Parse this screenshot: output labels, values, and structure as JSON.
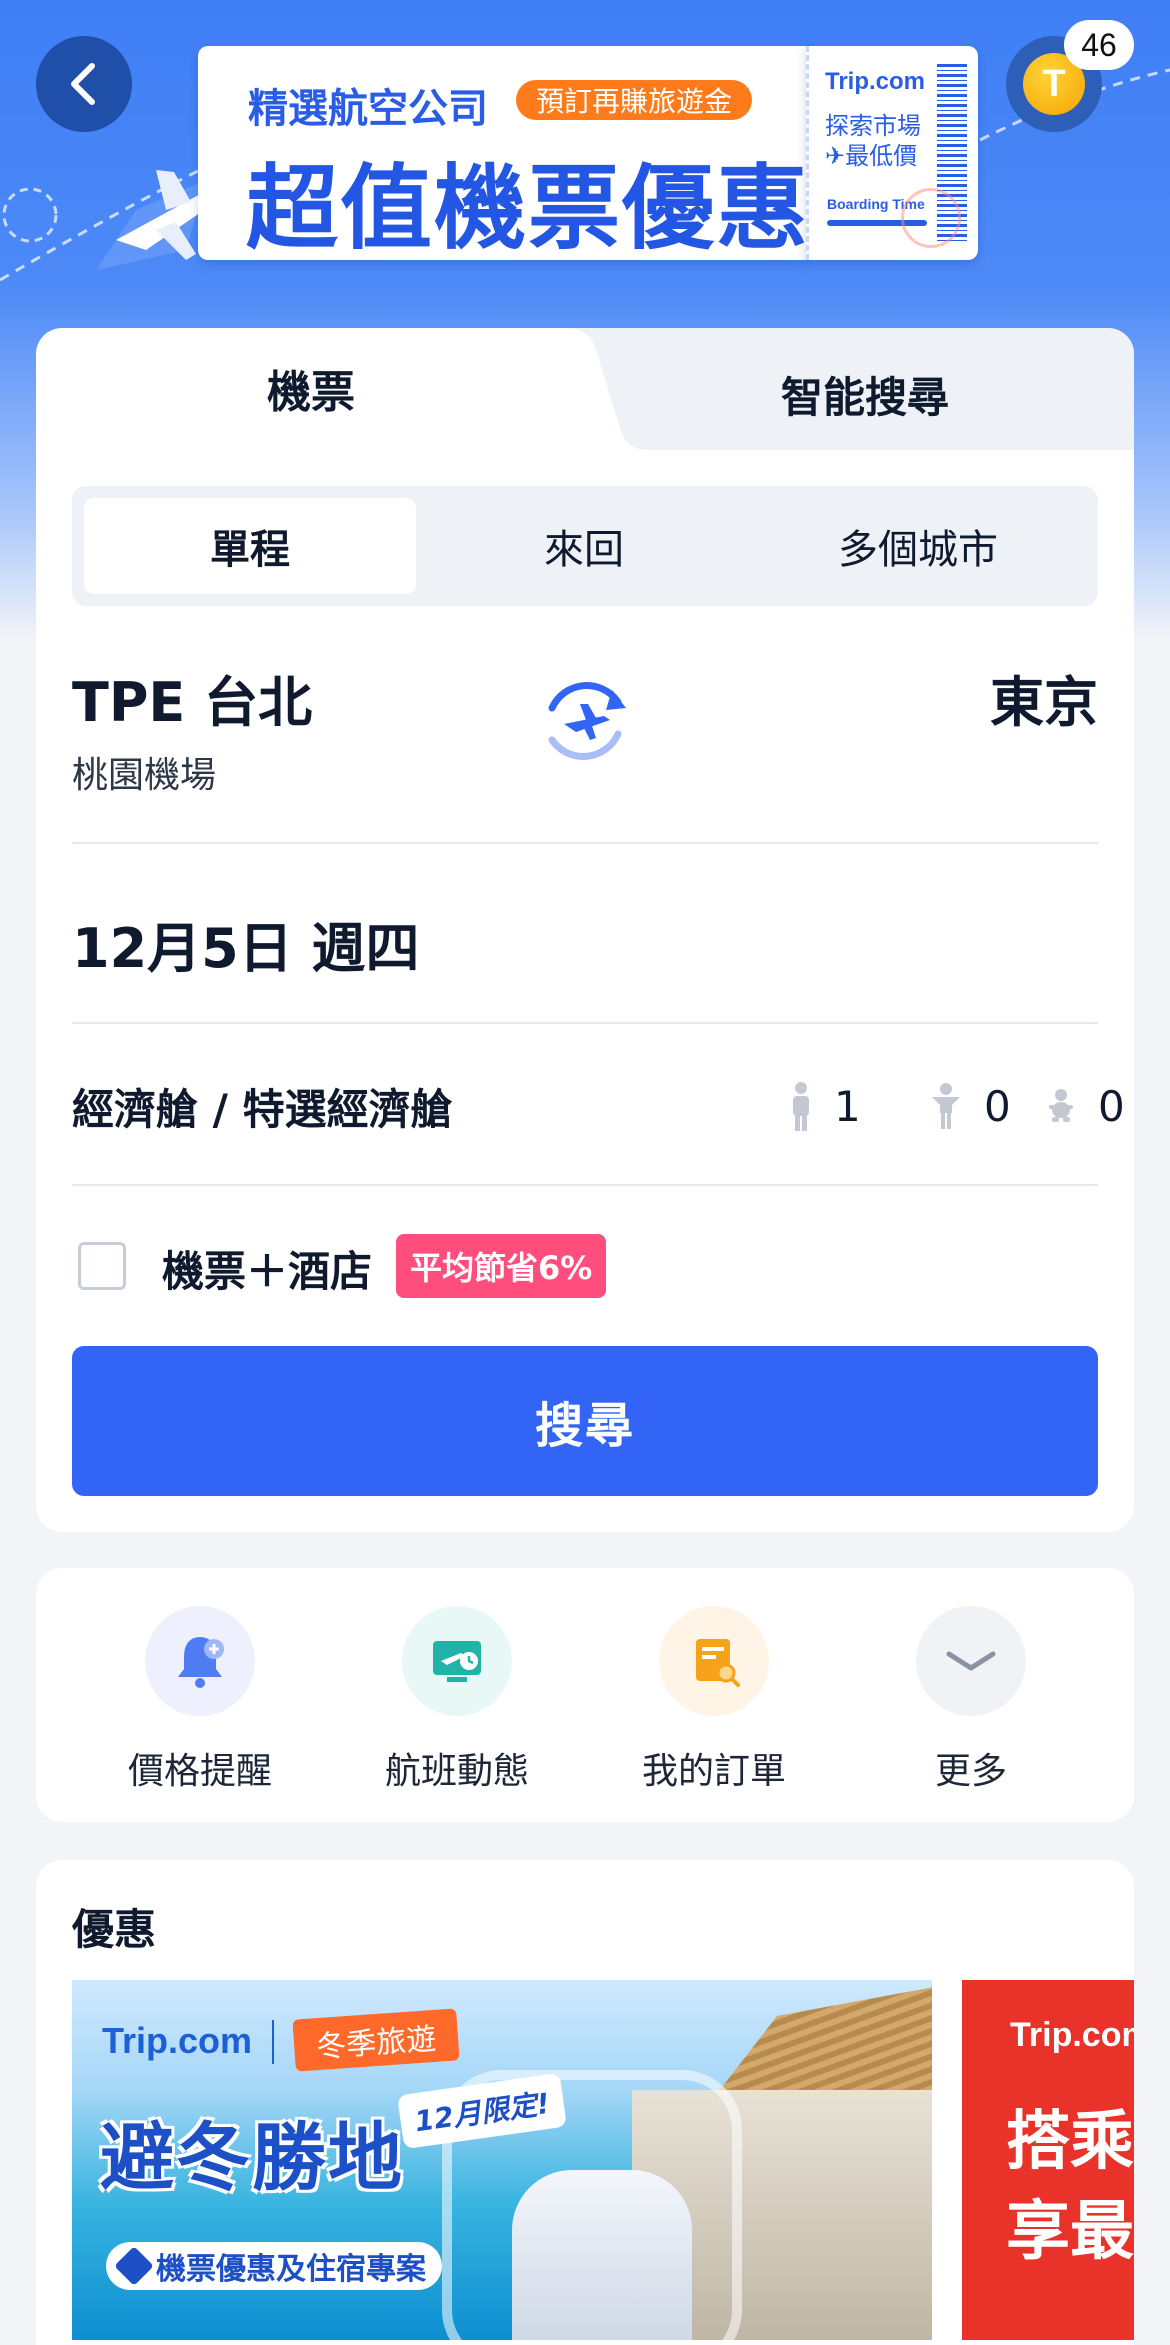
{
  "header": {
    "coin_letter": "T",
    "coin_count": "46"
  },
  "banner": {
    "line1": "精選航空公司",
    "pill": "預訂再賺旅遊金",
    "headline": "超值機票優惠",
    "ticket_brand": "Trip.com",
    "ticket_line1": "探索市場",
    "ticket_line2": "✈最低價",
    "ticket_small": "Boarding Time"
  },
  "tabs": {
    "flight": "機票",
    "smart_search": "智能搜尋"
  },
  "trip_type": {
    "options": [
      "單程",
      "來回",
      "多個城市"
    ],
    "selected": "單程"
  },
  "route": {
    "from_city": "TPE 台北",
    "from_airport": "桃園機場",
    "to_city": "東京"
  },
  "date": "12月5日 週四",
  "cabin_class": "經濟艙 / 特選經濟艙",
  "passengers": {
    "adults": "1",
    "children": "0",
    "infants": "0"
  },
  "bundle": {
    "label": "機票＋酒店",
    "badge": "平均節省6%",
    "checked": false
  },
  "search_button": "搜尋",
  "tools": [
    {
      "label": "價格提醒",
      "icon": "bell-plus-icon",
      "bg": "#eef1fd"
    },
    {
      "label": "航班動態",
      "icon": "monitor-clock-icon",
      "bg": "#e8f8f7"
    },
    {
      "label": "我的訂單",
      "icon": "order-doc-icon",
      "bg": "#fff4e6"
    },
    {
      "label": "更多",
      "icon": "chevron-down-icon",
      "bg": "#f1f2f5"
    }
  ],
  "deals": {
    "title": "優惠",
    "promo1": {
      "brand": "Trip.com",
      "ribbon": "冬季旅遊",
      "headline": "避冬勝地",
      "tag": "12月限定!",
      "subtitle": "機票優惠及住宿專案"
    },
    "promo2": {
      "brand": "Trip.com",
      "line1": "搭乘",
      "line2": "享最"
    }
  },
  "colors": {
    "primary": "#3264f5",
    "badge_pink": "#ff4d7e",
    "hero_blue": "#3f7ef6"
  }
}
